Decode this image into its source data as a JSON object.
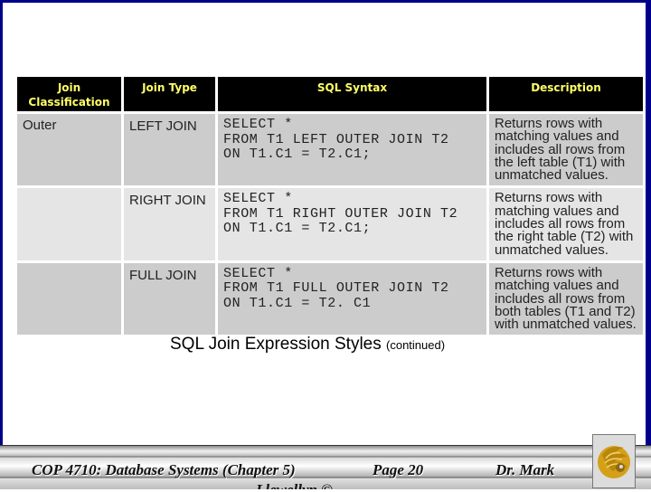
{
  "table": {
    "headers": [
      "Join Classification",
      "Join Type",
      "SQL Syntax",
      "Description"
    ],
    "header_class_line1": "Join",
    "header_class_line2": "Classification",
    "rows": [
      {
        "classification": "Outer",
        "join_type": "LEFT JOIN",
        "sql": "SELECT *\nFROM T1 LEFT OUTER JOIN T2\nON T1.C1 = T2.C1;",
        "description": "Returns rows with matching values and includes all rows from the left table (T1) with unmatched values."
      },
      {
        "classification": "",
        "join_type": "RIGHT JOIN",
        "sql": "SELECT *\nFROM T1 RIGHT OUTER JOIN T2\nON T1.C1 = T2.C1;",
        "description": "Returns rows with matching values and includes all rows from the right table (T2) with unmatched values."
      },
      {
        "classification": "",
        "join_type": "FULL JOIN",
        "sql": "SELECT *\nFROM T1 FULL OUTER JOIN T2\nON T1.C1 = T2. C1",
        "description": "Returns rows with matching values and includes all rows from both tables (T1 and T2) with unmatched values."
      }
    ]
  },
  "slide": {
    "title": "SQL Join Expression Styles",
    "title_suffix": "(continued)"
  },
  "footer": {
    "course": "COP 4710: Database Systems  (Chapter 5)",
    "page": "Page 20",
    "author": "Dr. Mark",
    "author_overflow": "Llewellyn ©"
  },
  "colors": {
    "frame": "#00008b",
    "header_bg": "#000000",
    "header_text": "#ffff66",
    "row_dark": "#cccccc",
    "row_light": "#e5e5e5",
    "logo_gold": "#d4a017"
  }
}
